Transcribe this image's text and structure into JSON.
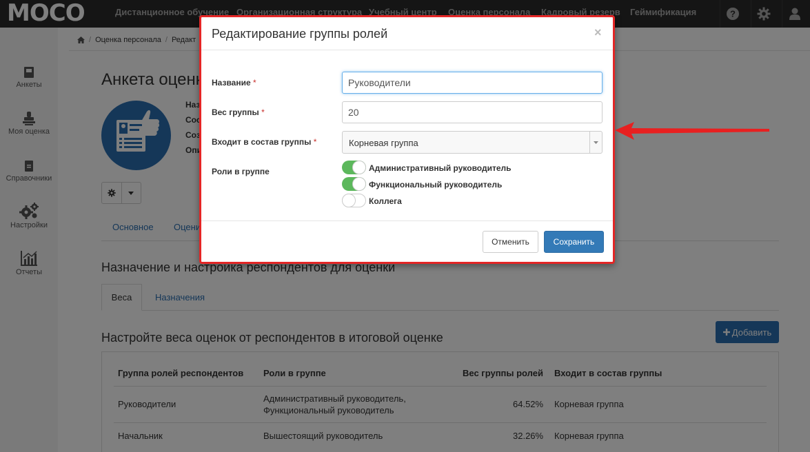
{
  "topbar": {
    "logo": "MOCO",
    "nav": [
      {
        "label": "Дистанционное обучение"
      },
      {
        "label": "Организационная структура"
      },
      {
        "label": "Учебный центр"
      },
      {
        "label": "Оценка персонала"
      },
      {
        "label": "Кадровый резерв"
      },
      {
        "label": "Геймификация"
      }
    ],
    "icons": [
      "help-icon",
      "settings-icon",
      "user-icon"
    ]
  },
  "sidebar": {
    "items": [
      {
        "label": "Анкеты",
        "icon": "book-icon"
      },
      {
        "label": "Моя оценка",
        "icon": "stamp-icon"
      },
      {
        "label": "Справочники",
        "icon": "file-icon"
      },
      {
        "label": "Настройки",
        "icon": "cogs-icon"
      },
      {
        "label": "Отчеты",
        "icon": "chart-icon"
      }
    ]
  },
  "breadcrumb": {
    "items": [
      "Оценка персонала",
      "Редакт"
    ]
  },
  "page": {
    "title": "Анкета оценк",
    "meta_labels": [
      "Наз",
      "Сос",
      "Соз",
      "Опи"
    ],
    "tabs": [
      {
        "label": "Основное"
      },
      {
        "label": "Оцени"
      }
    ],
    "section_title": "Назначение и настройка респондентов для оценки",
    "subtabs": [
      {
        "label": "Веса"
      },
      {
        "label": "Назначения"
      }
    ],
    "weights_title": "Настройте веса оценок от респондентов в итоговой оценке",
    "add_button": "Добавить",
    "table": {
      "headers": [
        "Группа ролей респондентов",
        "Роли в группе",
        "Вес группы ролей",
        "Входит в состав группы"
      ],
      "rows": [
        {
          "group": "Руководители",
          "roles_line1": "Административный руководитель,",
          "roles_line2": "Функциональный руководитель",
          "weight": "64.52%",
          "parent": "Корневая группа"
        },
        {
          "group": "Начальник",
          "roles_line1": "Вышестоящий руководитель",
          "roles_line2": "",
          "weight": "32.26%",
          "parent": "Корневая группа"
        }
      ]
    }
  },
  "modal": {
    "title": "Редактирование группы ролей",
    "close": "×",
    "name_label": "Название",
    "name_value": "Руководители",
    "weight_label": "Вес группы",
    "weight_value": "20",
    "parent_label": "Входит в состав группы",
    "parent_value": "Корневая группа",
    "roles_label": "Роли в группе",
    "required_mark": "*",
    "roles": [
      {
        "label": "Административный руководитель",
        "enabled": true
      },
      {
        "label": "Функциональный руководитель",
        "enabled": true
      },
      {
        "label": "Коллега",
        "enabled": false
      }
    ],
    "cancel": "Отменить",
    "save": "Сохранить"
  },
  "colors": {
    "accent": "#337ab7",
    "toggle_on": "#5cb85c",
    "highlight": "#e32626",
    "topbar": "#2b2b2b"
  }
}
